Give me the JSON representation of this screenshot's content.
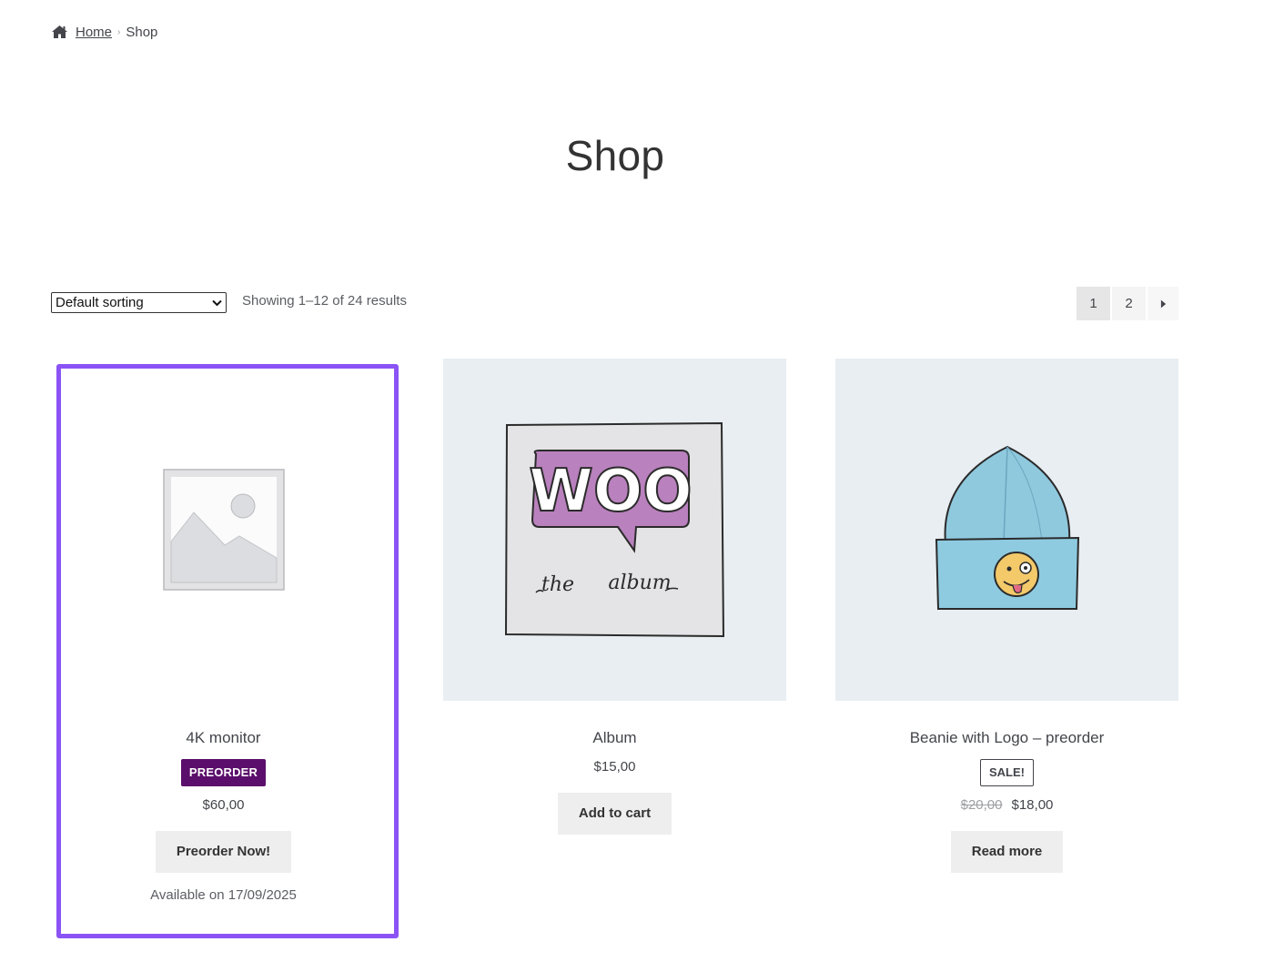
{
  "breadcrumb": {
    "home": "Home",
    "current": "Shop"
  },
  "page_title": "Shop",
  "toolbar": {
    "sort_selected": "Default sorting",
    "result_count": "Showing 1–12 of 24 results"
  },
  "pagination": {
    "pages": [
      "1",
      "2"
    ],
    "current": "1"
  },
  "products": [
    {
      "name": "4K monitor",
      "badge": "PREORDER",
      "price": "$60,00",
      "button": "Preorder Now!",
      "availability": "Available on 17/09/2025",
      "image": "placeholder-image-icon"
    },
    {
      "name": "Album",
      "price": "$15,00",
      "button": "Add to cart",
      "image": "woo-album-artwork",
      "art_text": "WOO",
      "art_caption_1": "the",
      "art_caption_2": "album"
    },
    {
      "name": "Beanie with Logo – preorder",
      "badge": "SALE!",
      "old_price": "$20,00",
      "price": "$18,00",
      "button": "Read more",
      "image": "beanie-artwork"
    }
  ],
  "colors": {
    "highlight": "#8b53f5",
    "preorder_badge": "#5b0e6b"
  }
}
